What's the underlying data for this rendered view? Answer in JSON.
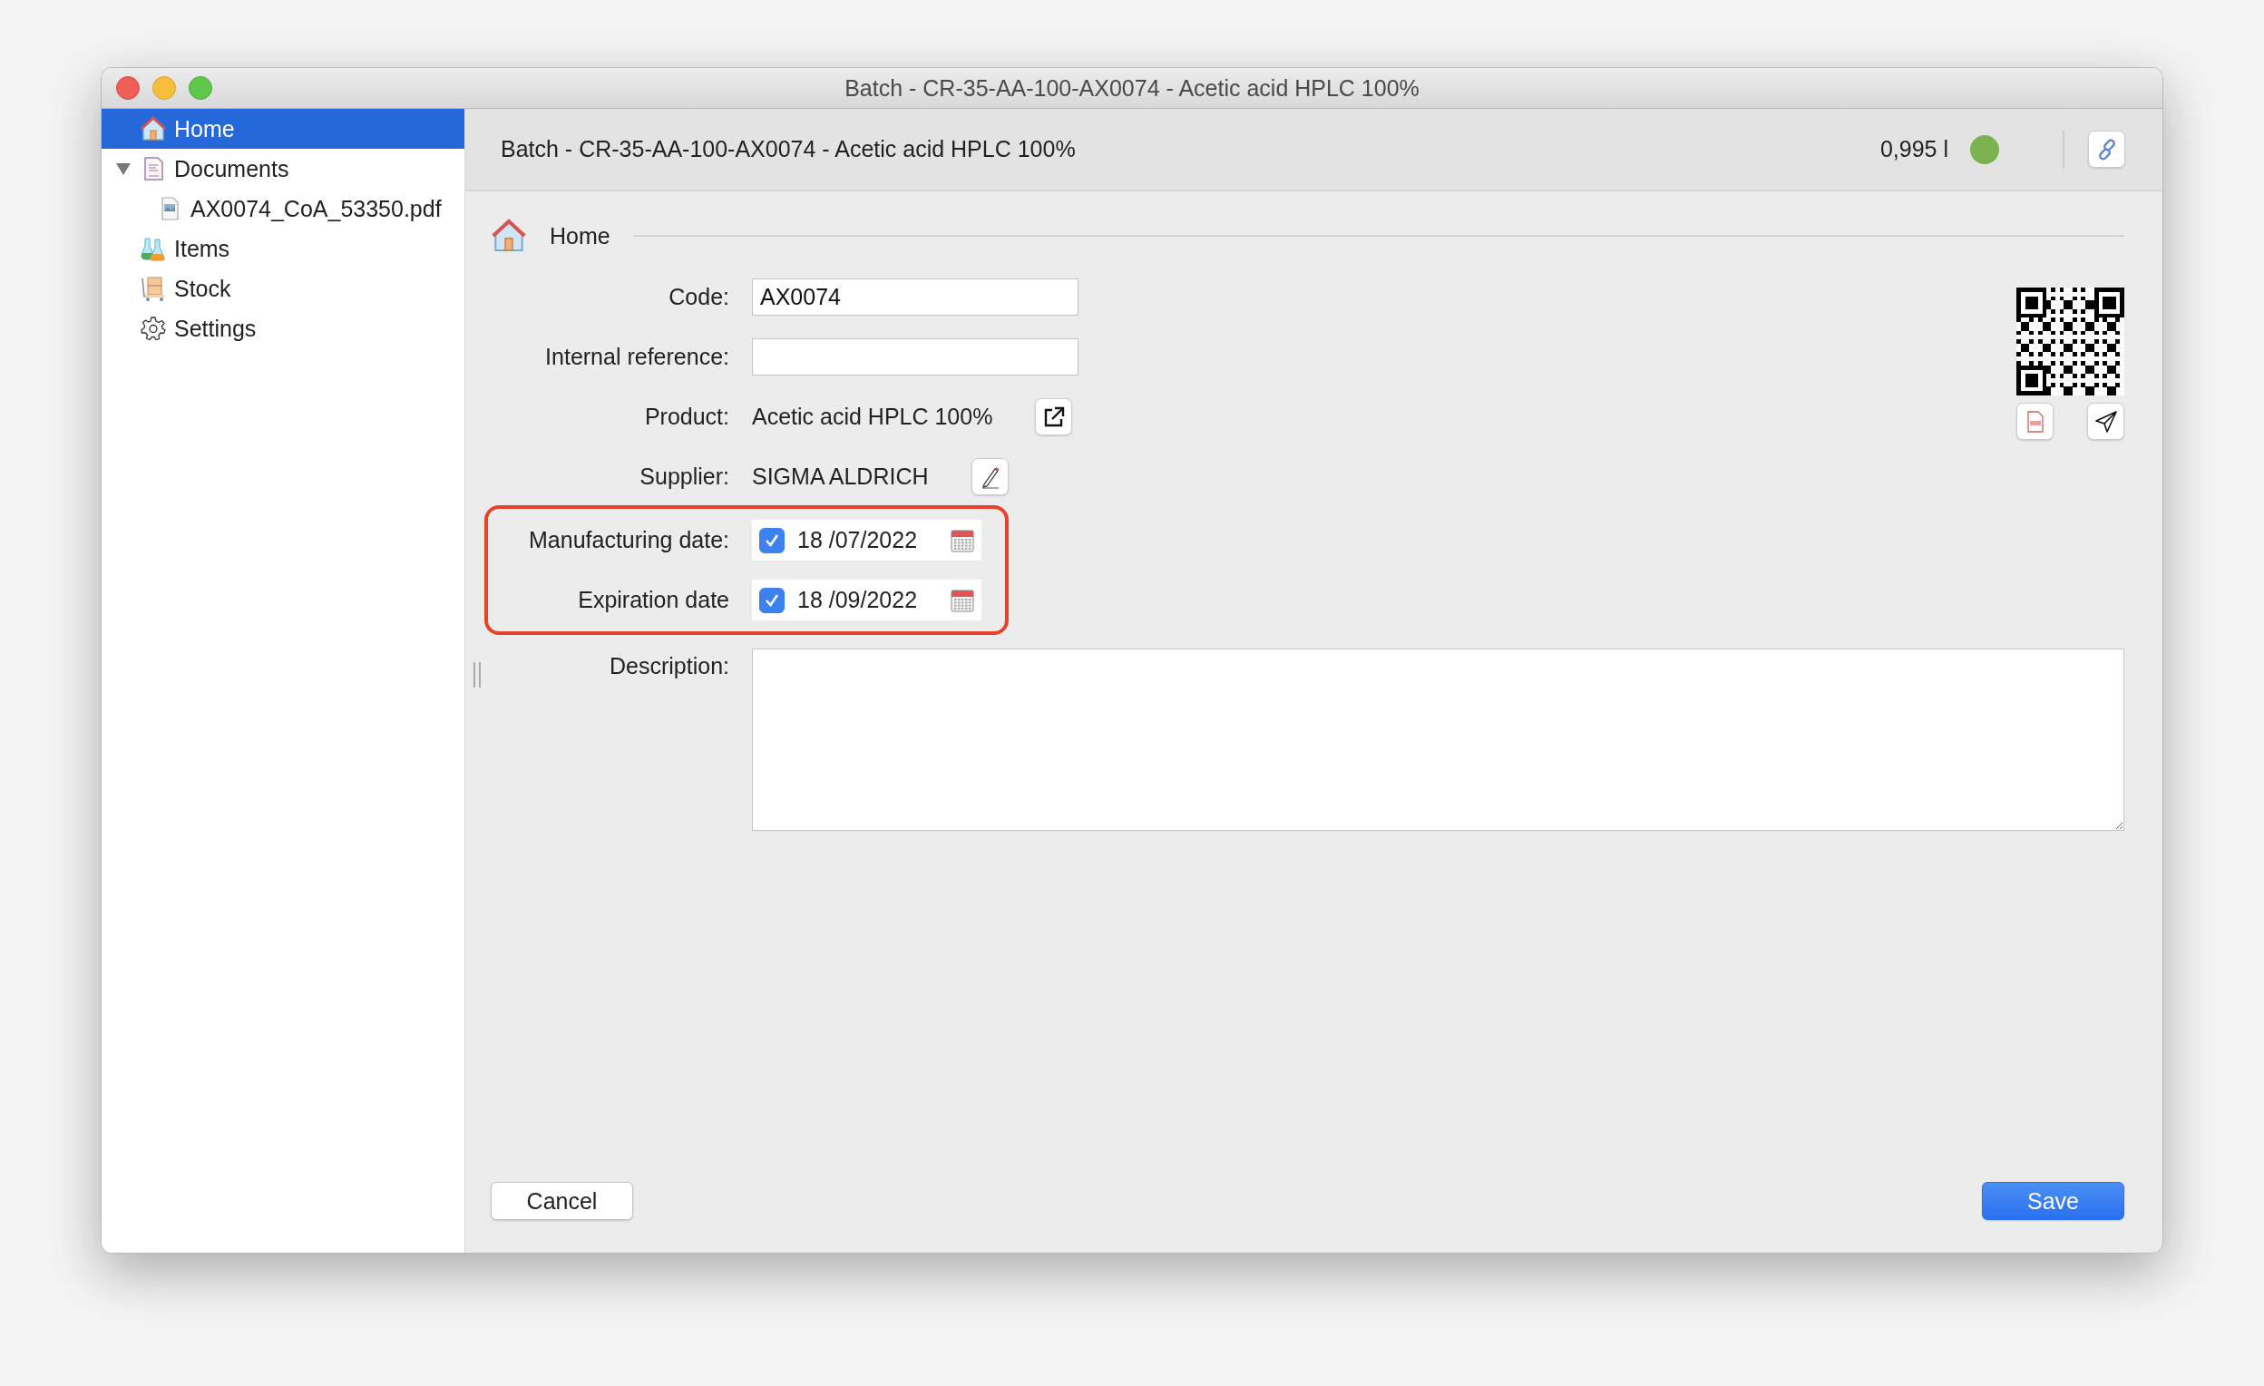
{
  "window": {
    "title": "Batch - CR-35-AA-100-AX0074 - Acetic acid HPLC 100%"
  },
  "sidebar": {
    "items": [
      {
        "label": "Home",
        "kind": "home",
        "selected": true
      },
      {
        "label": "Documents",
        "kind": "documents",
        "selected": false,
        "expanded": true,
        "children": [
          {
            "label": "AX0074_CoA_53350.pdf",
            "kind": "pdf",
            "selected": false
          }
        ]
      },
      {
        "label": "Items",
        "kind": "flasks",
        "selected": false
      },
      {
        "label": "Stock",
        "kind": "stock",
        "selected": false
      },
      {
        "label": "Settings",
        "kind": "gear",
        "selected": false
      }
    ]
  },
  "header": {
    "title": "Batch - CR-35-AA-100-AX0074 - Acetic acid HPLC 100%",
    "quantity": "0,995 l",
    "status": {
      "color": "#7cb350"
    }
  },
  "section": {
    "title": "Home"
  },
  "form": {
    "fields": [
      {
        "label": "Code:",
        "kind": "input",
        "value": "AX0074",
        "highlighted": false
      },
      {
        "label": "Internal reference:",
        "kind": "input",
        "highlighted": false
      },
      {
        "label": "Product:",
        "kind": "linked",
        "value": "Acetic acid HPLC 100%",
        "highlighted": false
      },
      {
        "label": "Supplier:",
        "kind": "editable",
        "value": "SIGMA ALDRICH",
        "highlighted": false
      },
      {
        "label": "Manufacturing date:",
        "kind": "date",
        "value": "18 /07/2022",
        "checked": true,
        "highlighted": true
      },
      {
        "label": "Expiration date",
        "kind": "date",
        "value": "18 /09/2022",
        "checked": true,
        "highlighted": true
      },
      {
        "label": "Description:",
        "kind": "textarea"
      }
    ]
  },
  "buttons": [
    {
      "label": "Cancel",
      "kind": "secondary"
    },
    {
      "label": "Save",
      "kind": "primary"
    }
  ]
}
